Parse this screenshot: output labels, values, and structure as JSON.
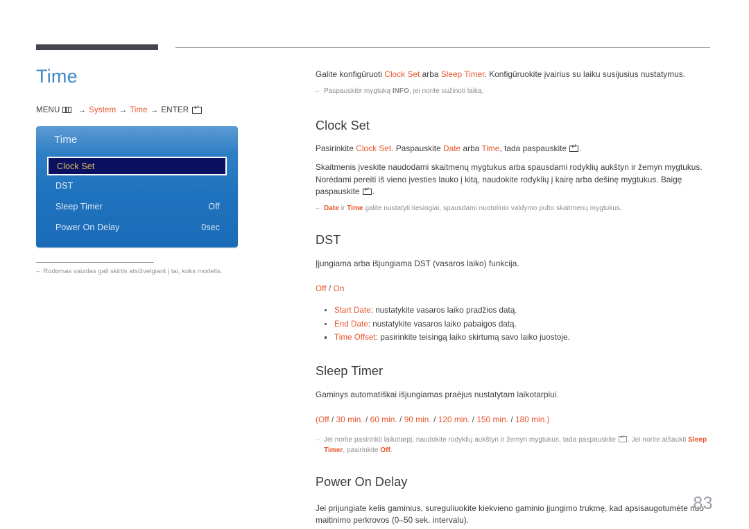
{
  "header": {
    "accent_bar_color": "#45444f",
    "rule_color": "#a8a8ae"
  },
  "left": {
    "title": "Time",
    "breadcrumb": {
      "menu_label": "MENU",
      "menu_icon": "menu-grid-icon",
      "arrow": "→",
      "item1": "System",
      "item2": "Time",
      "enter_label": "ENTER",
      "enter_icon": "enter-key-icon"
    },
    "osd": {
      "title": "Time",
      "rows": [
        {
          "label": "Clock Set",
          "value": "",
          "selected": true
        },
        {
          "label": "DST",
          "value": "",
          "selected": false
        },
        {
          "label": "Sleep Timer",
          "value": "Off",
          "selected": false
        },
        {
          "label": "Power On Delay",
          "value": "0sec",
          "selected": false
        }
      ]
    },
    "note": {
      "dash": "–",
      "text": "Rodomas vaizdas gali skirtis atsižvelgiant į tai, koks modelis."
    }
  },
  "right": {
    "intro": {
      "p1_a": "Galite konfigūruoti ",
      "p1_k1": "Clock Set",
      "p1_b": " arba ",
      "p1_k2": "Sleep Timer",
      "p1_c": ". Konfigūruokite įvairius su laiku susijusius nustatymus.",
      "note_dash": "–",
      "note_a": "Paspauskite mygtuką ",
      "note_k": "INFO",
      "note_b": ", jei norite sužinoti laiką."
    },
    "clock_set": {
      "heading": "Clock Set",
      "p1_a": "Pasirinkite ",
      "p1_k1": "Clock Set",
      "p1_b": ". Paspauskite ",
      "p1_k2": "Date",
      "p1_c": " arba ",
      "p1_k3": "Time",
      "p1_d": ", tada paspauskite ",
      "p1_e": ".",
      "p2": "Skaitmenis įveskite naudodami skaitmenų mygtukus arba spausdami rodyklių aukštyn ir žemyn mygtukus. Norėdami pereiti iš vieno įvesties lauko į kitą, naudokite rodyklių į kairę arba dešinę mygtukus. Baigę paspauskite",
      "p2_end": ".",
      "note_dash": "–",
      "note_k1": "Date",
      "note_a": " ir ",
      "note_k2": "Time",
      "note_b": " galite nustatyti tiesiogiai, spausdami nuotolinio valdymo pulto skaitmenų mygtukus."
    },
    "dst": {
      "heading": "DST",
      "p1": "Įjungiama arba išjungiama DST (vasaros laiko) funkcija.",
      "opt_off": "Off",
      "opt_sep": " / ",
      "opt_on": "On",
      "bullets": [
        {
          "key": "Start Date",
          "text": ": nustatykite vasaros laiko pradžios datą."
        },
        {
          "key": "End Date",
          "text": ": nustatykite vasaros laiko pabaigos datą."
        },
        {
          "key": "Time Offset",
          "text": ": pasirinkite teisingą laiko skirtumą savo laiko juostoje."
        }
      ]
    },
    "sleep_timer": {
      "heading": "Sleep Timer",
      "p1": "Gaminys automatiškai išjungiamas praėjus nustatytam laikotarpiui.",
      "options_open": "(",
      "options": [
        "Off",
        "30 min.",
        "60 min.",
        "90 min.",
        "120 min.",
        "150 min.",
        "180 min."
      ],
      "options_sep": " / ",
      "options_close": ")",
      "note_dash": "–",
      "note_a": "Jei norite pasirinkti laikotarpį, naudokite rodyklių aukštyn ir žemyn mygtukus, tada paspauskite ",
      "note_b": ". Jei norite atšaukti ",
      "note_k": "Sleep Timer",
      "note_c": ", pasirinkite ",
      "note_k2": "Off",
      "note_d": "."
    },
    "power_on_delay": {
      "heading": "Power On Delay",
      "p1": "Jei prijungiate kelis gaminius, sureguliuokite kiekvieno gaminio įjungimo trukmę, kad apsisaugotumėte nuo maitinimo perkrovos (0–50 sek. intervalu)."
    }
  },
  "footer": {
    "page_number": "83"
  },
  "colors": {
    "accent_orange": "#e8552d",
    "title_blue": "#3d88c8",
    "osd_blue_top": "#5d9bd4",
    "osd_blue_bottom": "#1b6cb8",
    "osd_selected_bg": "#0b1060",
    "osd_selected_text": "#e7c15c",
    "body_text": "#3c3c3c",
    "note_gray": "#8d8d95"
  }
}
